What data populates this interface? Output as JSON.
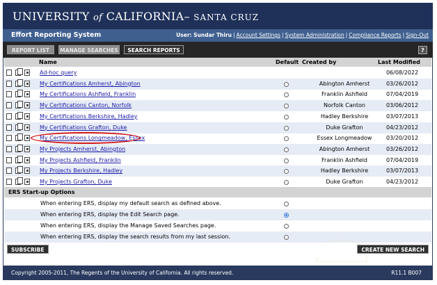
{
  "header": {
    "univ_part1": "UNIVERSITY ",
    "univ_of": "of",
    "univ_part2": " CALIFORNIA",
    "univ_sep": "– ",
    "univ_campus": "SANTA CRUZ"
  },
  "appbar": {
    "title": "Effort Reporting System",
    "user_label": "User: Sundar Thiru",
    "links": [
      "Account Settings",
      "System Administration",
      "Compliance Reports",
      "Sign-Out"
    ]
  },
  "toolbar": {
    "report_list": "REPORT LIST",
    "manage_searches": "MANAGE SEARCHES",
    "search_reports": "SEARCH REPORTS",
    "help": "?"
  },
  "table": {
    "headers": {
      "name": "Name",
      "default": "Default",
      "created_by": "Created by",
      "last_modified": "Last Modified"
    },
    "rows": [
      {
        "name": "Ad-hoc query",
        "created_by": "",
        "last_modified": "06/08/2022",
        "has_default": false
      },
      {
        "name": "My Certifications Amherst, Abington",
        "created_by": "Abington Amherst",
        "last_modified": "03/26/2012",
        "has_default": true
      },
      {
        "name": "My Certifications Ashfield, Franklin",
        "created_by": "Franklin Ashfield",
        "last_modified": "07/04/2019",
        "has_default": true
      },
      {
        "name": "My Certifications Canton, Norfolk",
        "created_by": "Norfolk Canton",
        "last_modified": "03/06/2012",
        "has_default": true
      },
      {
        "name": "My Certifications Berkshire, Hadley",
        "created_by": "Hadley Berkshire",
        "last_modified": "03/07/2013",
        "has_default": true
      },
      {
        "name": "My Certifications Grafton, Duke",
        "created_by": "Duke Grafton",
        "last_modified": "04/23/2012",
        "has_default": true
      },
      {
        "name": "My Certifications Longmeadow, Essex",
        "created_by": "Essex Longmeadow",
        "last_modified": "03/20/2012",
        "has_default": true
      },
      {
        "name": "My Projects Amherst, Abington",
        "created_by": "Abington Amherst",
        "last_modified": "03/26/2012",
        "has_default": true
      },
      {
        "name": "My Projects Ashfield, Franklin",
        "created_by": "Franklin Ashfield",
        "last_modified": "07/04/2019",
        "has_default": true
      },
      {
        "name": "My Projects Berkshire, Hadley",
        "created_by": "Hadley Berkshire",
        "last_modified": "03/07/2013",
        "has_default": true
      },
      {
        "name": "My Projects Grafton, Duke",
        "created_by": "Duke Grafton",
        "last_modified": "04/23/2012",
        "has_default": true
      }
    ]
  },
  "options": {
    "title": "ERS Start-up Options",
    "items": [
      {
        "text": "When entering ERS, display my default search as defined above.",
        "selected": false
      },
      {
        "text": "When entering ERS, display the Edit Search page.",
        "selected": true
      },
      {
        "text": "When entering ERS, display the Manage Saved Searches page.",
        "selected": false
      },
      {
        "text": "When entering ERS, display the search results from my last session.",
        "selected": false
      }
    ]
  },
  "buttons": {
    "subscribe": "SUBSCRIBE",
    "create_new_search": "CREATE NEW SEARCH"
  },
  "footer": {
    "copyright": "Copyright 2005-2011, The Regents of the University of California. All rights reserved.",
    "version": "R11.1 B007"
  },
  "colors": {
    "header_bg": "#1f3159",
    "appbar_bg": "#3f5f8f",
    "toolbar_bg": "#262626",
    "row_alt": "#e6ecf5",
    "link": "#1a1aa8",
    "highlight_ring": "#d11a1a"
  },
  "icons": [
    "document-icon",
    "copy-icon",
    "edit-icon"
  ]
}
